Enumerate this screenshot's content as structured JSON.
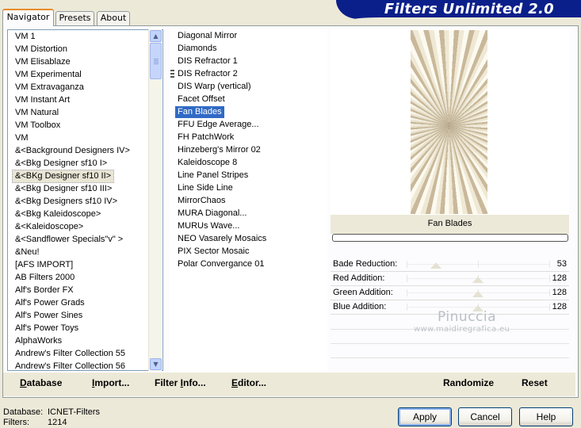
{
  "window": {
    "title": "Filters Unlimited 2.0"
  },
  "tabs": [
    {
      "label": "Navigator",
      "active": true
    },
    {
      "label": "Presets",
      "active": false
    },
    {
      "label": "About",
      "active": false
    }
  ],
  "categories": {
    "selected": "&<BKg Designer sf10 II>",
    "items": [
      "VM 1",
      "VM Distortion",
      "VM Elisablaze",
      "VM Experimental",
      "VM Extravaganza",
      "VM Instant Art",
      "VM Natural",
      "VM Toolbox",
      "VM",
      "&<Background Designers IV>",
      "&<Bkg Designer sf10 I>",
      "&<BKg Designer sf10 II>",
      "&<Bkg Designer sf10 III>",
      "&<Bkg Designers sf10 IV>",
      "&<Bkg Kaleidoscope>",
      "&<Kaleidoscope>",
      "&<Sandflower Specials\"v\" >",
      "&Neu!",
      "[AFS IMPORT]",
      "AB Filters 2000",
      "Alf's Border FX",
      "Alf's Power Grads",
      "Alf's Power Sines",
      "Alf's Power Toys",
      "AlphaWorks",
      "Andrew's Filter Collection 55",
      "Andrew's Filter Collection 56"
    ]
  },
  "filters": {
    "selected": "Fan Blades",
    "items": [
      "Diagonal Mirror",
      "Diamonds",
      "DIS Refractor 1",
      "DIS Refractor 2",
      "DIS Warp (vertical)",
      "Facet Offset",
      "Fan Blades",
      "FFU Edge Average...",
      "FH PatchWork",
      "Hinzeberg's Mirror 02",
      "Kaleidoscope 8",
      "Line Panel Stripes",
      "Line Side Line",
      "MirrorChaos",
      "MURA Diagonal...",
      "MURUs Wave...",
      "NEO Vasarely Mosaics",
      "PIX Sector Mosaic",
      "Polar Convergance 01"
    ]
  },
  "preview": {
    "caption": "Fan Blades"
  },
  "parameters": [
    {
      "label": "Bade Reduction:",
      "value": 53
    },
    {
      "label": "Red Addition:",
      "value": 128
    },
    {
      "label": "Green Addition:",
      "value": 128
    },
    {
      "label": "Blue Addition:",
      "value": 128
    }
  ],
  "watermark": {
    "name": "Pinuccia",
    "site": "www.maidiregrafica.eu"
  },
  "toolbar": {
    "database_u": "D",
    "database": "atabase",
    "import_u": "I",
    "import": "mport...",
    "filterinfo_pre": "Filter ",
    "filterinfo_u": "I",
    "filterinfo": "nfo...",
    "editor_u": "E",
    "editor": "ditor...",
    "randomize": "Randomize",
    "reset": "Reset"
  },
  "status": {
    "database_label": "Database:",
    "database_value": "ICNET-Filters",
    "filters_label": "Filters:",
    "filters_value": "1214"
  },
  "dialog": {
    "apply": "Apply",
    "cancel": "Cancel",
    "help": "Help"
  },
  "colors": {
    "banner": "#0b1f8a",
    "selection": "#316ac5",
    "face": "#ece9d8"
  }
}
